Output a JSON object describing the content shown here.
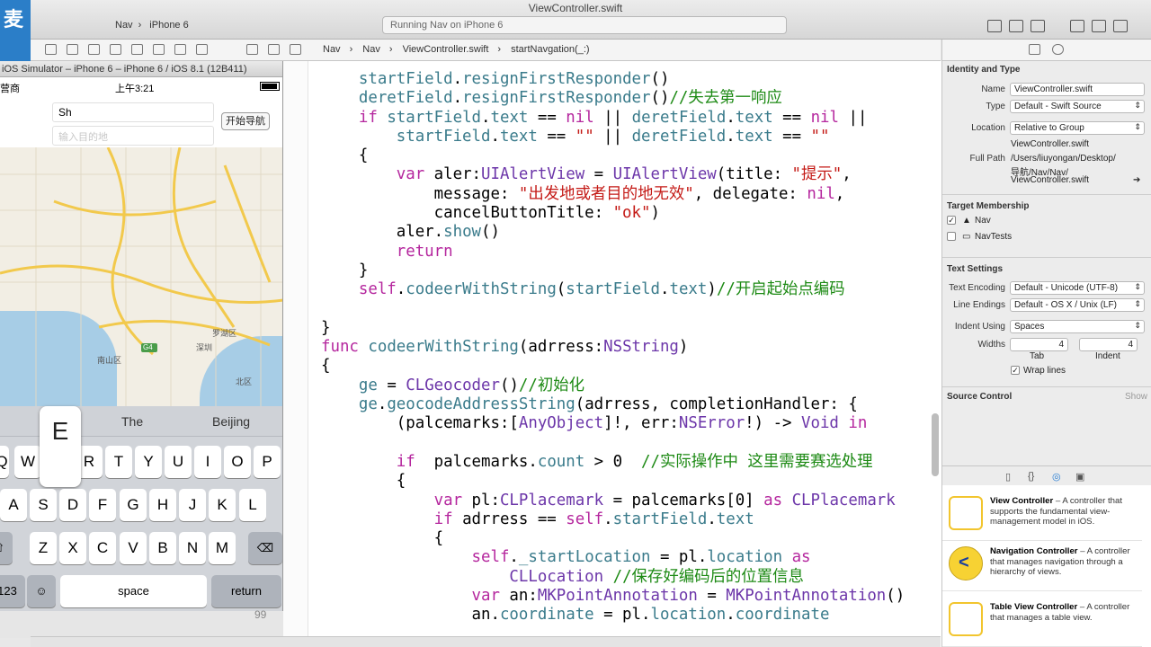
{
  "window": {
    "title": "ViewController.swift",
    "logo_text": "麦",
    "scheme_target": "Nav",
    "scheme_device": "iPhone 6",
    "status": "Running Nav on iPhone 6"
  },
  "jumpbar": {
    "items": [
      "Nav",
      "Nav",
      "ViewController.swift",
      "startNavgation(_:)"
    ]
  },
  "simulator": {
    "title": "iOS Simulator – iPhone 6 – iPhone 6 / iOS 8.1 (12B411)",
    "carrier": "营商",
    "time": "上午3:21",
    "start_value": "Sh",
    "dest_placeholder": "输入目的地",
    "nav_button": "开始导航",
    "map_labels": [
      "南山区",
      "深圳",
      "罗湖区",
      "北区",
      "G4"
    ],
    "predictions": [
      "The",
      "Beijing"
    ],
    "popup_key": "E",
    "keys_row1": [
      "Q",
      "W",
      "R",
      "T",
      "Y",
      "U",
      "I",
      "O",
      "P"
    ],
    "keys_row2": [
      "A",
      "S",
      "D",
      "F",
      "G",
      "H",
      "J",
      "K",
      "L"
    ],
    "keys_row3": [
      "Z",
      "X",
      "C",
      "V",
      "B",
      "N",
      "M"
    ],
    "key_numbers": "123",
    "key_space": "space",
    "key_return": "return",
    "line_number": "99"
  },
  "code": {
    "lines": [
      "    startField.resignFirstResponder()",
      "    deretField.resignFirstResponder()//失去第一响应",
      "    if startField.text == nil || deretField.text == nil ||",
      "        startField.text == \"\" || deretField.text == \"\"",
      "    {",
      "        var aler:UIAlertView = UIAlertView(title: \"提示\",",
      "            message: \"出发地或者目的地无效\", delegate: nil,",
      "            cancelButtonTitle: \"ok\")",
      "        aler.show()",
      "        return",
      "    }",
      "    self.codeerWithString(startField.text)//开启起始点编码",
      "",
      "}",
      "func codeerWithString(adrress:NSString)",
      "{",
      "    ge = CLGeocoder()//初始化",
      "    ge.geocodeAddressString(adrress, completionHandler: {",
      "        (palcemarks:[AnyObject]!, err:NSError!) -> Void in",
      "",
      "        if  palcemarks.count > 0  //实际操作中 这里需要赛选处理",
      "        {",
      "            var pl:CLPlacemark = palcemarks[0] as CLPlacemark",
      "            if adrress == self.startField.text",
      "            {",
      "                self._startLocation = pl.location as",
      "                    CLLocation //保存好编码后的位置信息",
      "                var an:MKPointAnnotation = MKPointAnnotation()",
      "                an.coordinate = pl.location.coordinate"
    ]
  },
  "inspector": {
    "identity_title": "Identity and Type",
    "name_label": "Name",
    "name_value": "ViewController.swift",
    "type_label": "Type",
    "type_value": "Default - Swift Source",
    "location_label": "Location",
    "location_value": "Relative to Group",
    "location_file": "ViewController.swift",
    "fullpath_label": "Full Path",
    "fullpath_value_1": "/Users/liuyongan/Desktop/",
    "fullpath_value_2": "导航/Nav/Nav/",
    "fullpath_value_3": "ViewController.swift",
    "target_title": "Target Membership",
    "target_nav": "Nav",
    "target_navtests": "NavTests",
    "text_title": "Text Settings",
    "encoding_label": "Text Encoding",
    "encoding_value": "Default - Unicode (UTF-8)",
    "endings_label": "Line Endings",
    "endings_value": "Default - OS X / Unix (LF)",
    "indent_label": "Indent Using",
    "indent_value": "Spaces",
    "widths_label": "Widths",
    "tab_value": "4",
    "indent_width_value": "4",
    "tab_label": "Tab",
    "indent_sub_label": "Indent",
    "wrap_label": "Wrap lines",
    "source_title": "Source Control",
    "source_show": "Show"
  },
  "library": [
    {
      "title": "View Controller",
      "desc": " – A controller that supports the fundamental view-management model in iOS."
    },
    {
      "title": "Navigation Controller",
      "desc": " – A controller that manages navigation through a hierarchy of views."
    },
    {
      "title": "Table View Controller",
      "desc": " – A controller that manages a table view."
    }
  ]
}
